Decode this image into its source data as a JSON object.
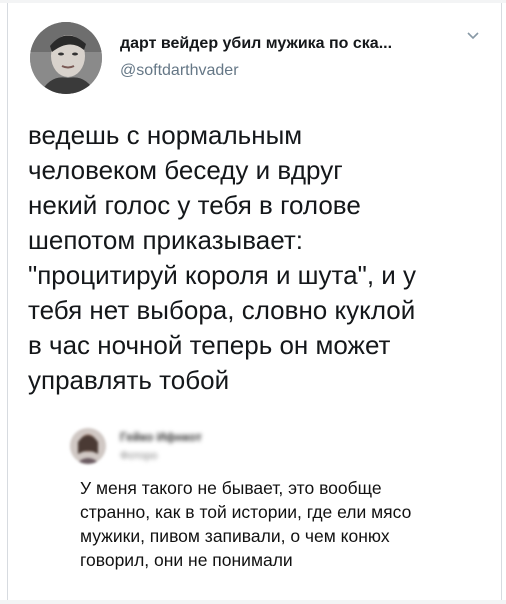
{
  "tweet": {
    "display_name": "дарт вейдер убил мужика по ска...",
    "handle": "@softdarthvader",
    "menu_icon": "chevron-down-icon",
    "text_lines": [
      "ведешь с нормальным",
      "человеком беседу и вдруг",
      "некий голос у тебя в голове",
      "шепотом приказывает:",
      "\"процитируй короля и шута\", и у",
      "тебя нет выбора, словно куклой",
      "в час ночной теперь он может",
      "управлять тобой"
    ]
  },
  "reply": {
    "name_blurred": "Гейко Ифнкот",
    "sub_blurred": "Фоторо",
    "text_lines": [
      "У меня такого не бывает, это вообще",
      "странно, как в той истории, где ели мясо",
      "мужики, пивом запивали, о чем конюх",
      "говорил, они не понимали"
    ]
  },
  "colors": {
    "name": "#14171a",
    "handle": "#657786",
    "chevron": "#8899a6"
  }
}
